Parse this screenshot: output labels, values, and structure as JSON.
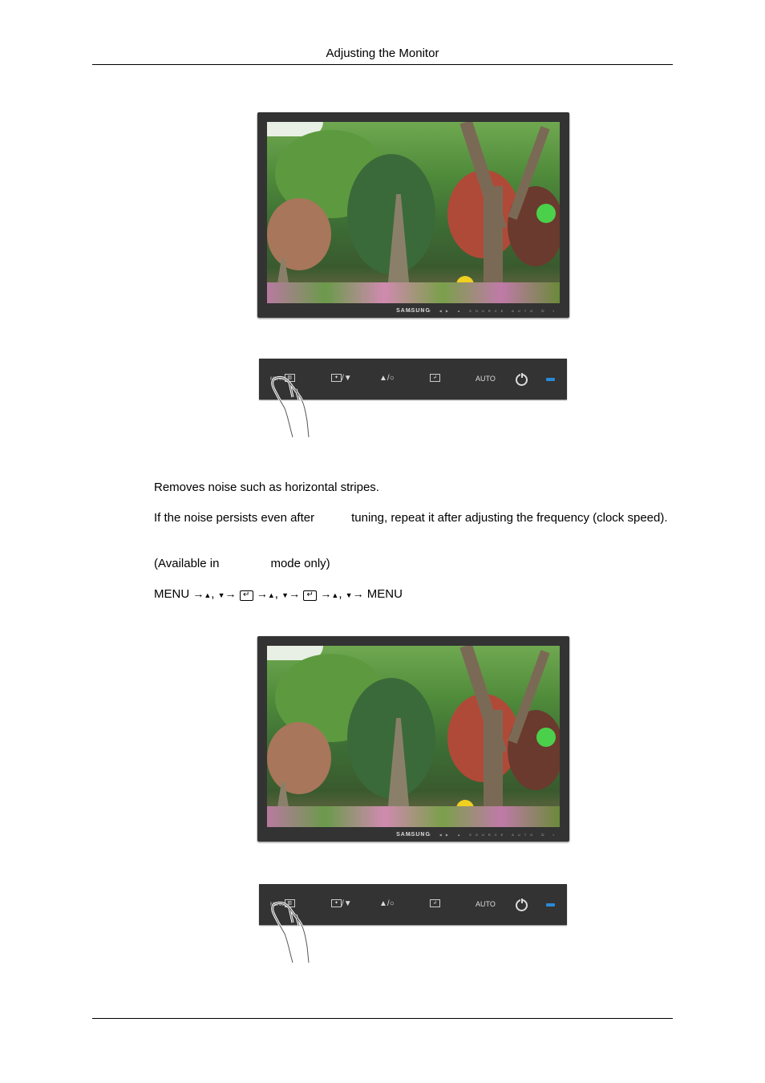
{
  "header": {
    "title": "Adjusting the Monitor"
  },
  "monitor": {
    "brand": "SAMSUNG",
    "front_buttons": "MENU ◀▶ ▲ SOURCE AUTO ⏻ ▪"
  },
  "panel": {
    "menu_label": "MENU",
    "menu_icon": "▥",
    "brightness_down": "/▼",
    "brightness_box": "✦",
    "up_label": "▲/",
    "up_circle": "○",
    "enter_icon": "↲",
    "auto_label": "AUTO",
    "power_icon": "power-icon",
    "led_color": "#2a8ad8"
  },
  "body": {
    "p1": "Removes noise such as horizontal stripes.",
    "p2_a": "If the noise persists even after",
    "p2_b": "tuning, repeat it after adjusting the frequency (clock speed).",
    "p3_a": "(Available in",
    "p3_b": "mode only)",
    "nav": {
      "menu_start": "MENU",
      "arrow": "→",
      "up": "▲",
      "comma": ",",
      "down": "▼",
      "enter": "↵",
      "menu_end": "MENU"
    }
  }
}
